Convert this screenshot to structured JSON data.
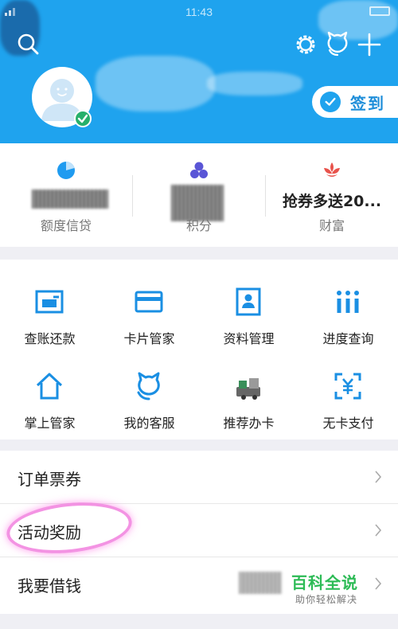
{
  "status_bar": {
    "time": "11:43"
  },
  "header": {
    "checkin_label": "签到"
  },
  "summary": [
    {
      "label": "额度信贷",
      "value": "",
      "icon": "credit-pie-icon",
      "color": "#1f9bf0"
    },
    {
      "label": "积分",
      "value": "",
      "icon": "points-dots-icon",
      "color": "#5a55d6"
    },
    {
      "label": "财富",
      "value": "抢券多送20...",
      "icon": "wealth-flower-icon",
      "color": "#e8524b"
    }
  ],
  "grid": [
    {
      "label": "查账还款",
      "icon": "bill-payment-icon"
    },
    {
      "label": "卡片管家",
      "icon": "card-icon"
    },
    {
      "label": "资料管理",
      "icon": "profile-icon"
    },
    {
      "label": "进度查询",
      "icon": "progress-icon"
    },
    {
      "label": "掌上管家",
      "icon": "home-icon"
    },
    {
      "label": "我的客服",
      "icon": "service-icon"
    },
    {
      "label": "推荐办卡",
      "icon": "recommend-card-icon"
    },
    {
      "label": "无卡支付",
      "icon": "cardless-pay-icon"
    }
  ],
  "list": [
    {
      "label": "订单票券"
    },
    {
      "label": "活动奖励"
    },
    {
      "label": "我要借钱"
    }
  ],
  "watermark": {
    "title": "百科全说",
    "subtitle": "助你轻松解决"
  },
  "colors": {
    "brand_blue": "#1fa3ee",
    "icon_blue": "#1a8fe3",
    "check_green": "#27b06b",
    "watermark_green": "#2dbb56"
  }
}
